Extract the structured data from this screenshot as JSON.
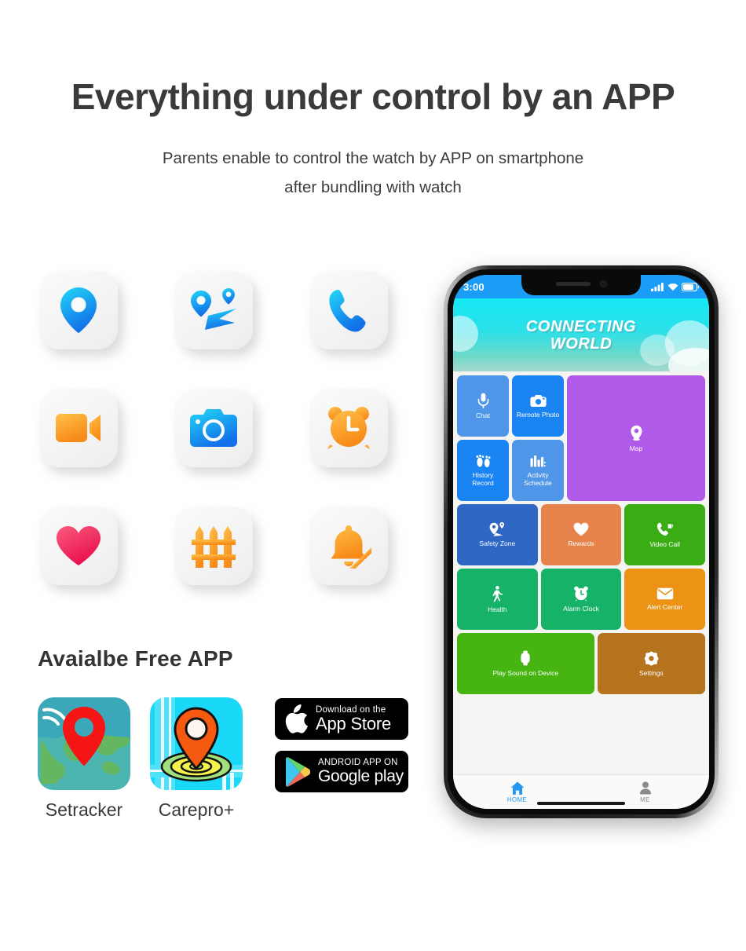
{
  "header": {
    "title": "Everything under control by an APP",
    "subtitle_line1": "Parents enable to control the watch by APP on smartphone",
    "subtitle_line2": "after bundling with watch"
  },
  "feature_icons": [
    {
      "name": "location-pin-icon",
      "color": "#1ec8f5"
    },
    {
      "name": "route-map-icon",
      "color": "#1ec8f5"
    },
    {
      "name": "phone-call-icon",
      "color": "#1ec8f5"
    },
    {
      "name": "video-camera-icon",
      "color": "#f9a826"
    },
    {
      "name": "camera-icon",
      "color": "#19c3f3"
    },
    {
      "name": "alarm-clock-icon",
      "color": "#f79a22"
    },
    {
      "name": "heart-icon",
      "color": "#f0326a"
    },
    {
      "name": "fence-icon",
      "color": "#f79a22"
    },
    {
      "name": "bell-off-icon",
      "color": "#f79a22"
    }
  ],
  "free_app": {
    "title": "Avaialbe Free APP",
    "apps": [
      {
        "label": "Setracker",
        "icon": "setracker-app-icon"
      },
      {
        "label": "Carepro+",
        "icon": "carepro-app-icon"
      }
    ],
    "badges": [
      {
        "icon": "apple-logo-icon",
        "small": "Download on the",
        "big": "App Store"
      },
      {
        "icon": "google-play-icon",
        "small": "ANDROID APP ON",
        "big": "Google play"
      }
    ]
  },
  "phone": {
    "statusbar": {
      "time": "3:00",
      "icons": [
        "signal-bars-icon",
        "wifi-icon",
        "battery-icon"
      ],
      "background": "#1b9cf7"
    },
    "banner": {
      "line1": "CONNECTING",
      "line2": "WORLD"
    },
    "tiles": {
      "row1": [
        {
          "label": "Chat",
          "icon": "microphone-icon",
          "color": "#4f95e8"
        },
        {
          "label": "Remote Photo",
          "icon": "camera-icon",
          "color": "#1a84f2"
        },
        {
          "label": "Map",
          "icon": "map-pin-icon",
          "color": "#b159e8"
        }
      ],
      "row2": [
        {
          "label": "History\nRecord",
          "icon": "footprints-icon",
          "color": "#1a84f2"
        },
        {
          "label": "Activity\nSchedule",
          "icon": "chart-bars-icon",
          "color": "#4f95e8"
        }
      ],
      "row3": [
        {
          "label": "Safety Zone",
          "icon": "geofence-pin-icon",
          "color": "#2f67c4"
        },
        {
          "label": "Rewards",
          "icon": "heart-icon",
          "color": "#e5834a"
        },
        {
          "label": "Video Call",
          "icon": "video-phone-icon",
          "color": "#3aad14"
        }
      ],
      "row4": [
        {
          "label": "Health",
          "icon": "walking-person-icon",
          "color": "#16b267"
        },
        {
          "label": "Alarm Clock",
          "icon": "alarm-clock-icon",
          "color": "#16b267"
        },
        {
          "label": "Alert Center",
          "icon": "envelope-icon",
          "color": "#ec9316"
        }
      ],
      "row5": [
        {
          "label": "Play Sound on Device",
          "icon": "smartwatch-icon",
          "color": "#46b512"
        },
        {
          "label": "Settings",
          "icon": "gear-icon",
          "color": "#b5731e"
        }
      ]
    },
    "navbar": [
      {
        "label": "HOME",
        "icon": "home-icon",
        "active": true,
        "color": "#2196f3"
      },
      {
        "label": "ME",
        "icon": "person-icon",
        "active": false,
        "color": "#8b8b8b"
      }
    ]
  }
}
